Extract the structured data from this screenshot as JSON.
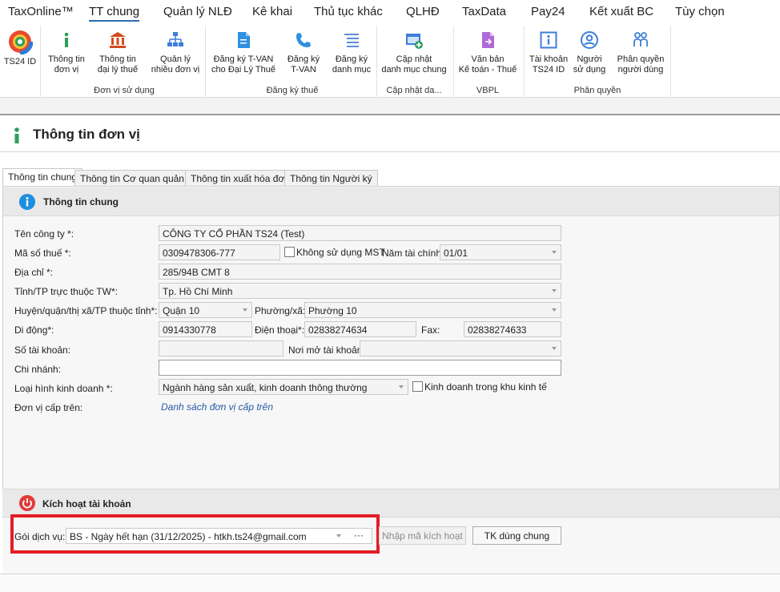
{
  "menu": {
    "items": [
      "TaxOnline™",
      "TT chung",
      "Quản lý NLĐ",
      "Kê khai",
      "Thủ tục khác",
      "QLHĐ",
      "TaxData",
      "Pay24",
      "Kết xuất BC",
      "Tùy chọn"
    ],
    "active": "TT chung"
  },
  "ribbon": {
    "ts24id": "TS24 ID",
    "thong_tin_don_vi": [
      "Thông tin",
      "đơn vị"
    ],
    "thong_tin_dai_ly": [
      "Thông tin",
      "đại lý thuế"
    ],
    "quan_ly_nhieu": [
      "Quản lý",
      "nhiều đơn vị"
    ],
    "dang_ky_tvan_dai_ly": [
      "Đăng ký T-VAN",
      "cho Đại Lý Thuế"
    ],
    "dang_ky_tvan": [
      "Đăng ký",
      "T-VAN"
    ],
    "dang_ky_danh_muc": [
      "Đăng ký",
      "danh mục"
    ],
    "cap_nhat_danh_muc": [
      "Cập nhật",
      "danh mục chung"
    ],
    "van_ban": [
      "Văn bản",
      "Kế toán - Thuế"
    ],
    "tai_khoan": [
      "Tài khoản",
      "TS24 ID"
    ],
    "nguoi_su_dung": [
      "Người",
      "sử dụng"
    ],
    "phan_quyen": [
      "Phân quyền",
      "người dùng"
    ],
    "groups": {
      "don_vi": "Đơn vị sử dụng",
      "dang_ky_thue": "Đăng ký thuế",
      "cap_nhat": "Cập nhật da...",
      "vbpl": "VBPL",
      "phan_quyen": "Phân quyền"
    }
  },
  "page": {
    "title": "Thông tin đơn vị"
  },
  "tabs": [
    "Thông tin chung",
    "Thông tin Cơ quan quản lý",
    "Thông tin xuất hóa đơn",
    "Thông tin Người ký"
  ],
  "general": {
    "section_title": "Thông tin chung",
    "labels": {
      "ten_cong_ty": "Tên công ty *:",
      "ma_so_thue": "Mã số thuế *:",
      "khong_su_dung_mst": "Không sử dụng MST",
      "nam_tai_chinh": "Năm tài chính:",
      "dia_chi": "Địa chỉ *:",
      "tinh_tp": "Tỉnh/TP trực thuộc TW*:",
      "huyen_quan": "Huyện/quận/thị xã/TP thuộc tỉnh*:",
      "phuong_xa": "Phường/xã:",
      "di_dong": "Di động*:",
      "dien_thoai": "Điện thoại*:",
      "fax": "Fax:",
      "so_tai_khoan": "Số tài khoản:",
      "noi_mo_tai_khoan": "Nơi mở tài khoản:",
      "chi_nhanh": "Chi nhánh:",
      "loai_hinh": "Loại hình kinh doanh *:",
      "kinh_doanh_khu_kinh_te": "Kinh doanh trong khu kinh tế",
      "don_vi_cap_tren": "Đơn vị cấp trên:"
    },
    "values": {
      "ten_cong_ty": "CÔNG TY CỔ PHẦN TS24 (Test)",
      "ma_so_thue": "0309478306-777",
      "nam_tai_chinh": "01/01",
      "dia_chi": "285/94B CMT 8",
      "tinh_tp": "Tp. Hồ Chí Minh",
      "huyen_quan": "Quận 10",
      "phuong_xa": "Phường 10",
      "di_dong": "0914330778",
      "dien_thoai": "02838274634",
      "fax": "02838274633",
      "so_tai_khoan": "",
      "noi_mo_tai_khoan": "",
      "chi_nhanh": "",
      "loai_hinh": "Ngành hàng sản xuất, kinh doanh thông thường"
    },
    "link_don_vi_cap_tren": "Danh sách đơn vị cấp trên"
  },
  "activation": {
    "section_title": "Kích hoạt tài khoản",
    "goi_dich_vu_label": "Gói dịch vụ:",
    "goi_dich_vu_value": "BS - Ngày hết hạn (31/12/2025) - htkh.ts24@gmail.com",
    "ellipsis": "···",
    "nhap_ma_btn": "Nhập mã kích hoạt",
    "tk_dung_chung_btn": "TK dùng chung"
  },
  "colors": {
    "accent": "#2b6cb0",
    "highlight_box": "#e21d24",
    "link": "#2759a8",
    "info_icon": "#1d8fe0",
    "power_icon": "#e23a3a"
  }
}
